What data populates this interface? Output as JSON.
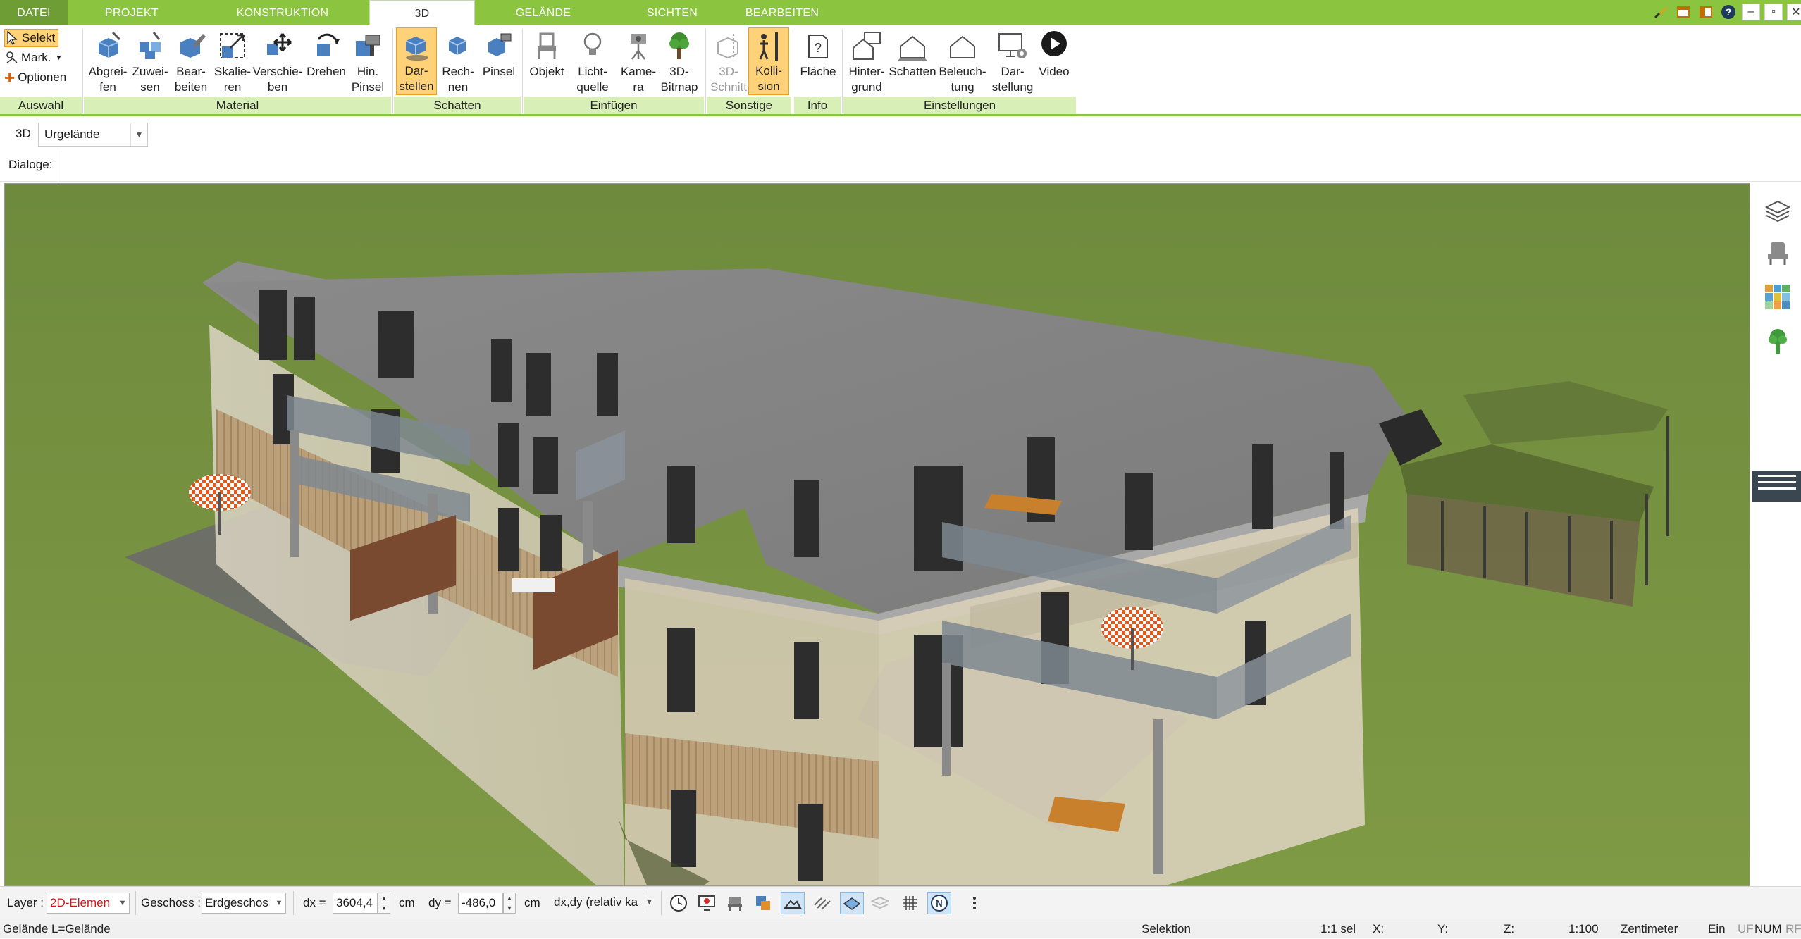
{
  "tabs": [
    {
      "label": "DATEI"
    },
    {
      "label": "PROJEKT"
    },
    {
      "label": "KONSTRUKTION"
    },
    {
      "label": "3D"
    },
    {
      "label": "GELÄNDE"
    },
    {
      "label": "SICHTEN"
    },
    {
      "label": "BEARBEITEN"
    }
  ],
  "window_controls": [
    "brush-icon",
    "window-icon",
    "layout-icon",
    "help-icon",
    "minimize",
    "restore",
    "close"
  ],
  "window_glyphs": {
    "minimize": "–",
    "restore": "▫",
    "close": "✕"
  },
  "auswahl": {
    "selekt": "Selekt",
    "mark": "Mark.",
    "optionen": "Optionen"
  },
  "ribbon": {
    "material": [
      "Abgrei-\nfen",
      "Zuwei-\nsen",
      "Bear-\nbeiten",
      "Skalie-\nren",
      "Verschie-\nben",
      "Drehen",
      "Hin.\nPinsel"
    ],
    "schatten": [
      "Dar-\nstellen",
      "Rech-\nnen",
      "Pinsel"
    ],
    "einfuegen": [
      "Objekt",
      "Licht-\nquelle",
      "Kame-\nra",
      "3D-\nBitmap"
    ],
    "sonstige": [
      "3D-\nSchnitt",
      "Kolli-\nsion"
    ],
    "info": [
      "Fläche"
    ],
    "einstellungen": [
      "Hinter-\ngrund",
      "Schatten",
      "Beleuch-\ntung",
      "Dar-\nstellung",
      "Video"
    ]
  },
  "groups": [
    "Auswahl",
    "Material",
    "Schatten",
    "Einfügen",
    "Sonstige",
    "Info",
    "Einstellungen"
  ],
  "view_row": {
    "label": "3D",
    "terrain_select": "Urgelände",
    "dialoge_label": "Dialoge:"
  },
  "statusbar": {
    "layer_label": "Layer :",
    "layer_value": "2D-Elemen",
    "geschoss_label": "Geschoss :",
    "geschoss_value": "Erdgeschos",
    "dx_label": "dx =",
    "dx_value": "3604,4",
    "dx_unit": "cm",
    "dy_label": "dy =",
    "dy_value": "-486,0",
    "dy_unit": "cm",
    "mode_value": "dx,dy (relativ ka",
    "status_left": "Gelände L=Gelände",
    "status_mode": "Selektion",
    "scale_sel": "1:1 sel",
    "x_label": "X:",
    "y_label": "Y:",
    "z_label": "Z:",
    "scale": "1:100",
    "unit": "Zentimeter",
    "ein": "Ein",
    "uf": "UF",
    "num": "NUM",
    "rf": "RF"
  },
  "colors": {
    "accent": "#8bc53f",
    "accent_dark": "#6e9c35",
    "group_label": "#d8f0b8",
    "selected": "#ffd27a",
    "grass": "#7a9440"
  }
}
